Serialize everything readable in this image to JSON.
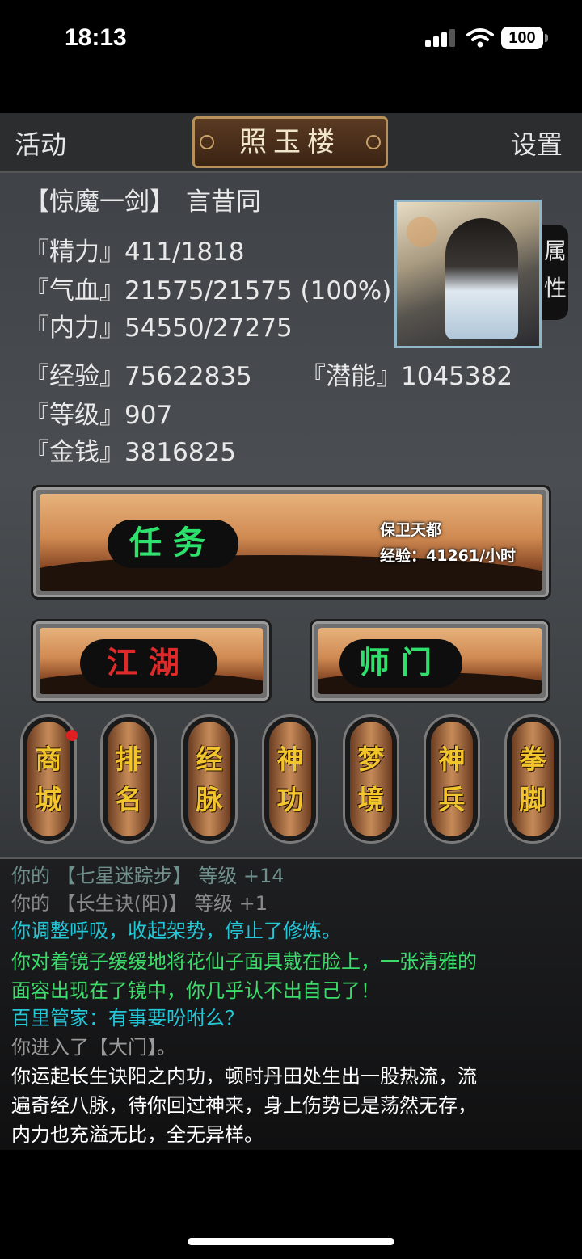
{
  "status_bar": {
    "time": "18:13",
    "battery": "100"
  },
  "topbar": {
    "left": "活动",
    "title": "照玉楼",
    "right": "设置"
  },
  "character": {
    "title": "【惊魔一剑】",
    "name": "言昔同",
    "stats": [
      {
        "label": "『精力』",
        "value": "411/1818"
      },
      {
        "label": "『气血』",
        "value": "21575/21575 (100%)"
      },
      {
        "label": "『内力』",
        "value": "54550/27275"
      },
      {
        "label": "『经验』",
        "value": "75622835"
      },
      {
        "label": "『潜能』",
        "value": "1045382"
      },
      {
        "label": "『等级』",
        "value": "907"
      },
      {
        "label": "『金钱』",
        "value": "3816825"
      }
    ],
    "attr_tab": "属性"
  },
  "task": {
    "label": "任务",
    "info_title": "保卫天都",
    "info_exp": "经验：41261/小时"
  },
  "buttons": {
    "jianghu": "江湖",
    "shimen": "师门"
  },
  "nav": [
    "商城",
    "排名",
    "经脉",
    "神功",
    "梦境",
    "神兵",
    "拳脚"
  ],
  "log": [
    {
      "text": "你的 【七星迷踪步】 等级 +14",
      "color": "#6f8f8c"
    },
    {
      "text": "你的 【长生诀(阳)】 等级 +1",
      "color": "#8a8a8a"
    },
    {
      "text": "你调整呼吸，收起架势，停止了修炼。",
      "color": "#22c8d8"
    },
    {
      "text": "你对着镜子缓缓地将花仙子面具戴在脸上，一张清雅的",
      "color": "#3cdc6a"
    },
    {
      "text": "面容出现在了镜中，你几乎认不出自己了！",
      "color": "#3cdc6a"
    },
    {
      "text": "百里管家：有事要吩咐么？",
      "color": "#22c8d8"
    },
    {
      "text": "你进入了【大门】。",
      "color": "#9a9a9a"
    },
    {
      "text": "你运起长生诀阳之内功，顿时丹田处生出一股热流，流",
      "color": "#ffffff"
    },
    {
      "text": "遍奇经八脉，待你回过神来，身上伤势已是荡然无存，",
      "color": "#ffffff"
    },
    {
      "text": "内力也充溢无比，全无异样。",
      "color": "#ffffff"
    }
  ]
}
